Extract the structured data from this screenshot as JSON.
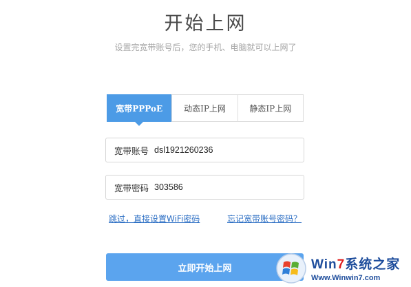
{
  "header": {
    "title": "开始上网",
    "subtitle": "设置完宽带账号后，您的手机、电脑就可以上网了"
  },
  "tabs": [
    {
      "label": "宽带PPPoE",
      "active": true
    },
    {
      "label": "动态IP上网",
      "active": false
    },
    {
      "label": "静态IP上网",
      "active": false
    }
  ],
  "form": {
    "account": {
      "label": "宽带账号",
      "value": "dsl1921260236"
    },
    "password": {
      "label": "宽带密码",
      "value": "303586"
    }
  },
  "links": {
    "skip": "跳过，直接设置WiFi密码",
    "forgot": "忘记宽带账号密码？"
  },
  "submit_label": "立即开始上网",
  "watermark": {
    "brand_prefix": "Win",
    "brand_seven": "7",
    "brand_suffix": "系统之家",
    "url": "Www.Winwin7.com"
  },
  "colors": {
    "accent": "#4c9be6",
    "button": "#5ba4ee",
    "link": "#2d6fc4"
  }
}
